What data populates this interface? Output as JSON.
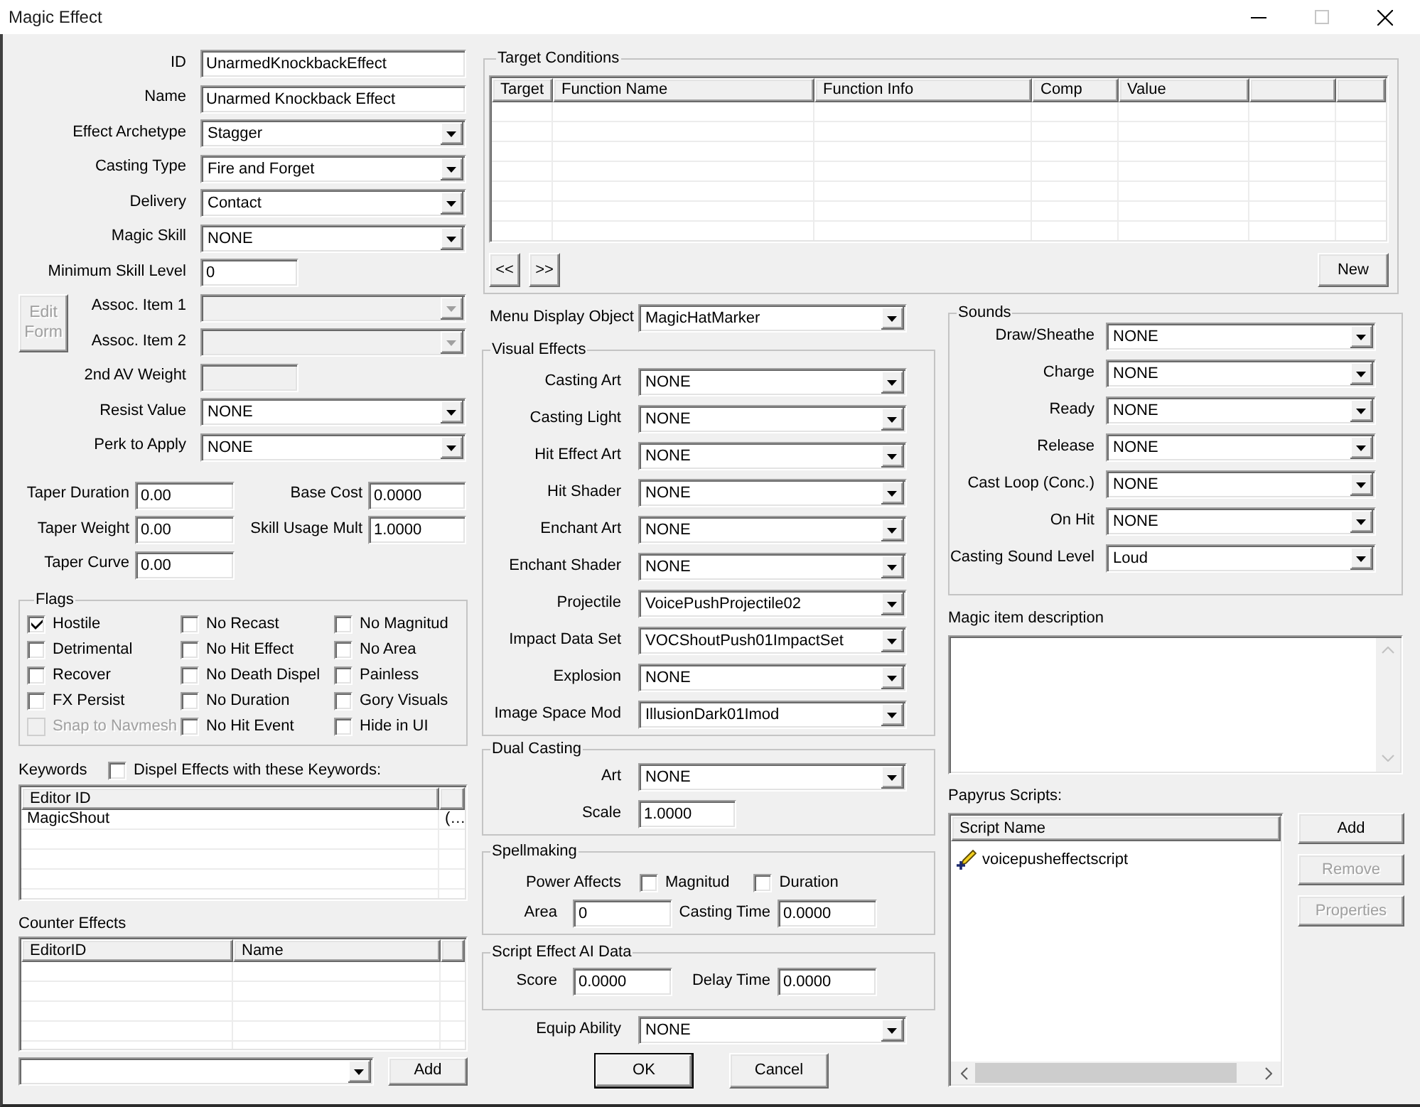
{
  "window": {
    "title": "Magic Effect",
    "controls": [
      {
        "kind": "minimize",
        "disabled": false
      },
      {
        "kind": "maximize",
        "disabled": true
      },
      {
        "kind": "close",
        "disabled": false
      }
    ]
  },
  "record_fields": [
    {
      "kind": "text",
      "label": "ID",
      "value": "UnarmedKnockbackEffect",
      "disabled": false
    },
    {
      "kind": "text",
      "label": "Name",
      "value": "Unarmed Knockback Effect",
      "disabled": false
    },
    {
      "kind": "dropdown",
      "label": "Effect Archetype",
      "value": "Stagger",
      "disabled": false
    },
    {
      "kind": "dropdown",
      "label": "Casting Type",
      "value": "Fire and Forget",
      "disabled": false
    },
    {
      "kind": "dropdown",
      "label": "Delivery",
      "value": "Contact",
      "disabled": false
    },
    {
      "kind": "dropdown",
      "label": "Magic Skill",
      "value": "NONE",
      "disabled": false
    },
    {
      "kind": "short_text",
      "label": "Minimum Skill Level",
      "value": "0",
      "disabled": false
    },
    {
      "kind": "dropdown",
      "label": "Assoc. Item 1",
      "disabled": true
    },
    {
      "kind": "dropdown",
      "label": "Assoc. Item 2",
      "disabled": true
    },
    {
      "kind": "short_text",
      "label": "2nd AV Weight",
      "disabled": true
    },
    {
      "kind": "dropdown",
      "label": "Resist Value",
      "value": "NONE",
      "disabled": false
    },
    {
      "kind": "dropdown",
      "label": "Perk to Apply",
      "value": "NONE",
      "disabled": false
    }
  ],
  "edit_form_button": {
    "label": "Edit Form",
    "disabled": true
  },
  "cost_fields": [
    {
      "label": "Taper Duration",
      "value": "0.00"
    },
    {
      "label": "Base Cost",
      "value": "0.0000"
    },
    {
      "label": "Taper Weight",
      "value": "0.00"
    },
    {
      "label": "Skill Usage Mult",
      "value": "1.0000"
    },
    {
      "label": "Taper Curve",
      "value": "0.00"
    }
  ],
  "flags": {
    "title": "Flags",
    "items": [
      {
        "label": "Hostile",
        "checked": true,
        "disabled": false
      },
      {
        "label": "No Recast",
        "checked": false,
        "disabled": false
      },
      {
        "label": "No Magnitud",
        "checked": false,
        "disabled": false
      },
      {
        "label": "Detrimental",
        "checked": false,
        "disabled": false
      },
      {
        "label": "No Hit Effect",
        "checked": false,
        "disabled": false
      },
      {
        "label": "No Area",
        "checked": false,
        "disabled": false
      },
      {
        "label": "Recover",
        "checked": false,
        "disabled": false
      },
      {
        "label": "No Death Dispel",
        "checked": false,
        "disabled": false
      },
      {
        "label": "Painless",
        "checked": false,
        "disabled": false
      },
      {
        "label": "FX Persist",
        "checked": false,
        "disabled": false
      },
      {
        "label": "No Duration",
        "checked": false,
        "disabled": false
      },
      {
        "label": "Gory Visuals",
        "checked": false,
        "disabled": false
      },
      {
        "label": "Snap to Navmesh",
        "checked": false,
        "disabled": true
      },
      {
        "label": "No Hit Event",
        "checked": false,
        "disabled": false
      },
      {
        "label": "Hide in UI",
        "checked": false,
        "disabled": false
      }
    ]
  },
  "keywords": {
    "label": "Keywords",
    "dispel_option": {
      "label": "Dispel Effects with these Keywords:",
      "checked": false
    },
    "columns": [
      "Editor ID"
    ],
    "rows": [
      [
        "MagicShout",
        "(…"
      ]
    ]
  },
  "counter_effects": {
    "label": "Counter Effects",
    "columns": [
      "EditorID",
      "Name"
    ],
    "add_button": "Add"
  },
  "target_conditions": {
    "title": "Target Conditions",
    "columns": [
      "Target",
      "Function Name",
      "Function Info",
      "Comp",
      "Value"
    ],
    "buttons": [
      "<<",
      ">>",
      "New"
    ]
  },
  "menu_display_object": {
    "label": "Menu Display Object",
    "value": "MagicHatMarker"
  },
  "visual_effects": {
    "title": "Visual Effects",
    "fields": [
      {
        "label": "Casting Art",
        "value": "NONE"
      },
      {
        "label": "Casting Light",
        "value": "NONE"
      },
      {
        "label": "Hit Effect Art",
        "value": "NONE"
      },
      {
        "label": "Hit Shader",
        "value": "NONE"
      },
      {
        "label": "Enchant Art",
        "value": "NONE"
      },
      {
        "label": "Enchant Shader",
        "value": "NONE"
      },
      {
        "label": "Projectile",
        "value": "VoicePushProjectile02"
      },
      {
        "label": "Impact Data Set",
        "value": "VOCShoutPush01ImpactSet"
      },
      {
        "label": "Explosion",
        "value": "NONE"
      },
      {
        "label": "Image Space Mod",
        "value": "IllusionDark01Imod"
      }
    ]
  },
  "dual_casting": {
    "title": "Dual Casting",
    "fields": [
      {
        "kind": "dropdown",
        "label": "Art",
        "value": "NONE"
      },
      {
        "kind": "short_text",
        "label": "Scale",
        "value": "1.0000"
      }
    ]
  },
  "spellmaking": {
    "title": "Spellmaking",
    "power_label": "Power Affects",
    "power_options": [
      {
        "label": "Magnitud",
        "checked": false
      },
      {
        "label": "Duration",
        "checked": false
      }
    ],
    "fields": [
      {
        "label": "Area",
        "value": "0"
      },
      {
        "label": "Casting Time",
        "value": "0.0000"
      }
    ]
  },
  "script_ai": {
    "title": "Script Effect AI Data",
    "fields": [
      {
        "label": "Score",
        "value": "0.0000"
      },
      {
        "label": "Delay Time",
        "value": "0.0000"
      }
    ]
  },
  "equip_ability": {
    "label": "Equip Ability",
    "value": "NONE"
  },
  "dialog_buttons": [
    {
      "label": "OK",
      "default": true
    },
    {
      "label": "Cancel",
      "default": false
    }
  ],
  "sounds": {
    "title": "Sounds",
    "fields": [
      {
        "label": "Draw/Sheathe",
        "value": "NONE"
      },
      {
        "label": "Charge",
        "value": "NONE"
      },
      {
        "label": "Ready",
        "value": "NONE"
      },
      {
        "label": "Release",
        "value": "NONE"
      },
      {
        "label": "Cast Loop (Conc.)",
        "value": "NONE"
      },
      {
        "label": "On Hit",
        "value": "NONE"
      },
      {
        "label": "Casting Sound Level",
        "value": "Loud"
      }
    ]
  },
  "description": {
    "label": "Magic item description"
  },
  "papyrus_scripts": {
    "label": "Papyrus Scripts:",
    "columns": [
      "Script Name"
    ],
    "rows": [
      "voicepusheffectscript"
    ],
    "buttons": [
      {
        "label": "Add",
        "disabled": false
      },
      {
        "label": "Remove",
        "disabled": true
      },
      {
        "label": "Properties",
        "disabled": true
      }
    ]
  }
}
